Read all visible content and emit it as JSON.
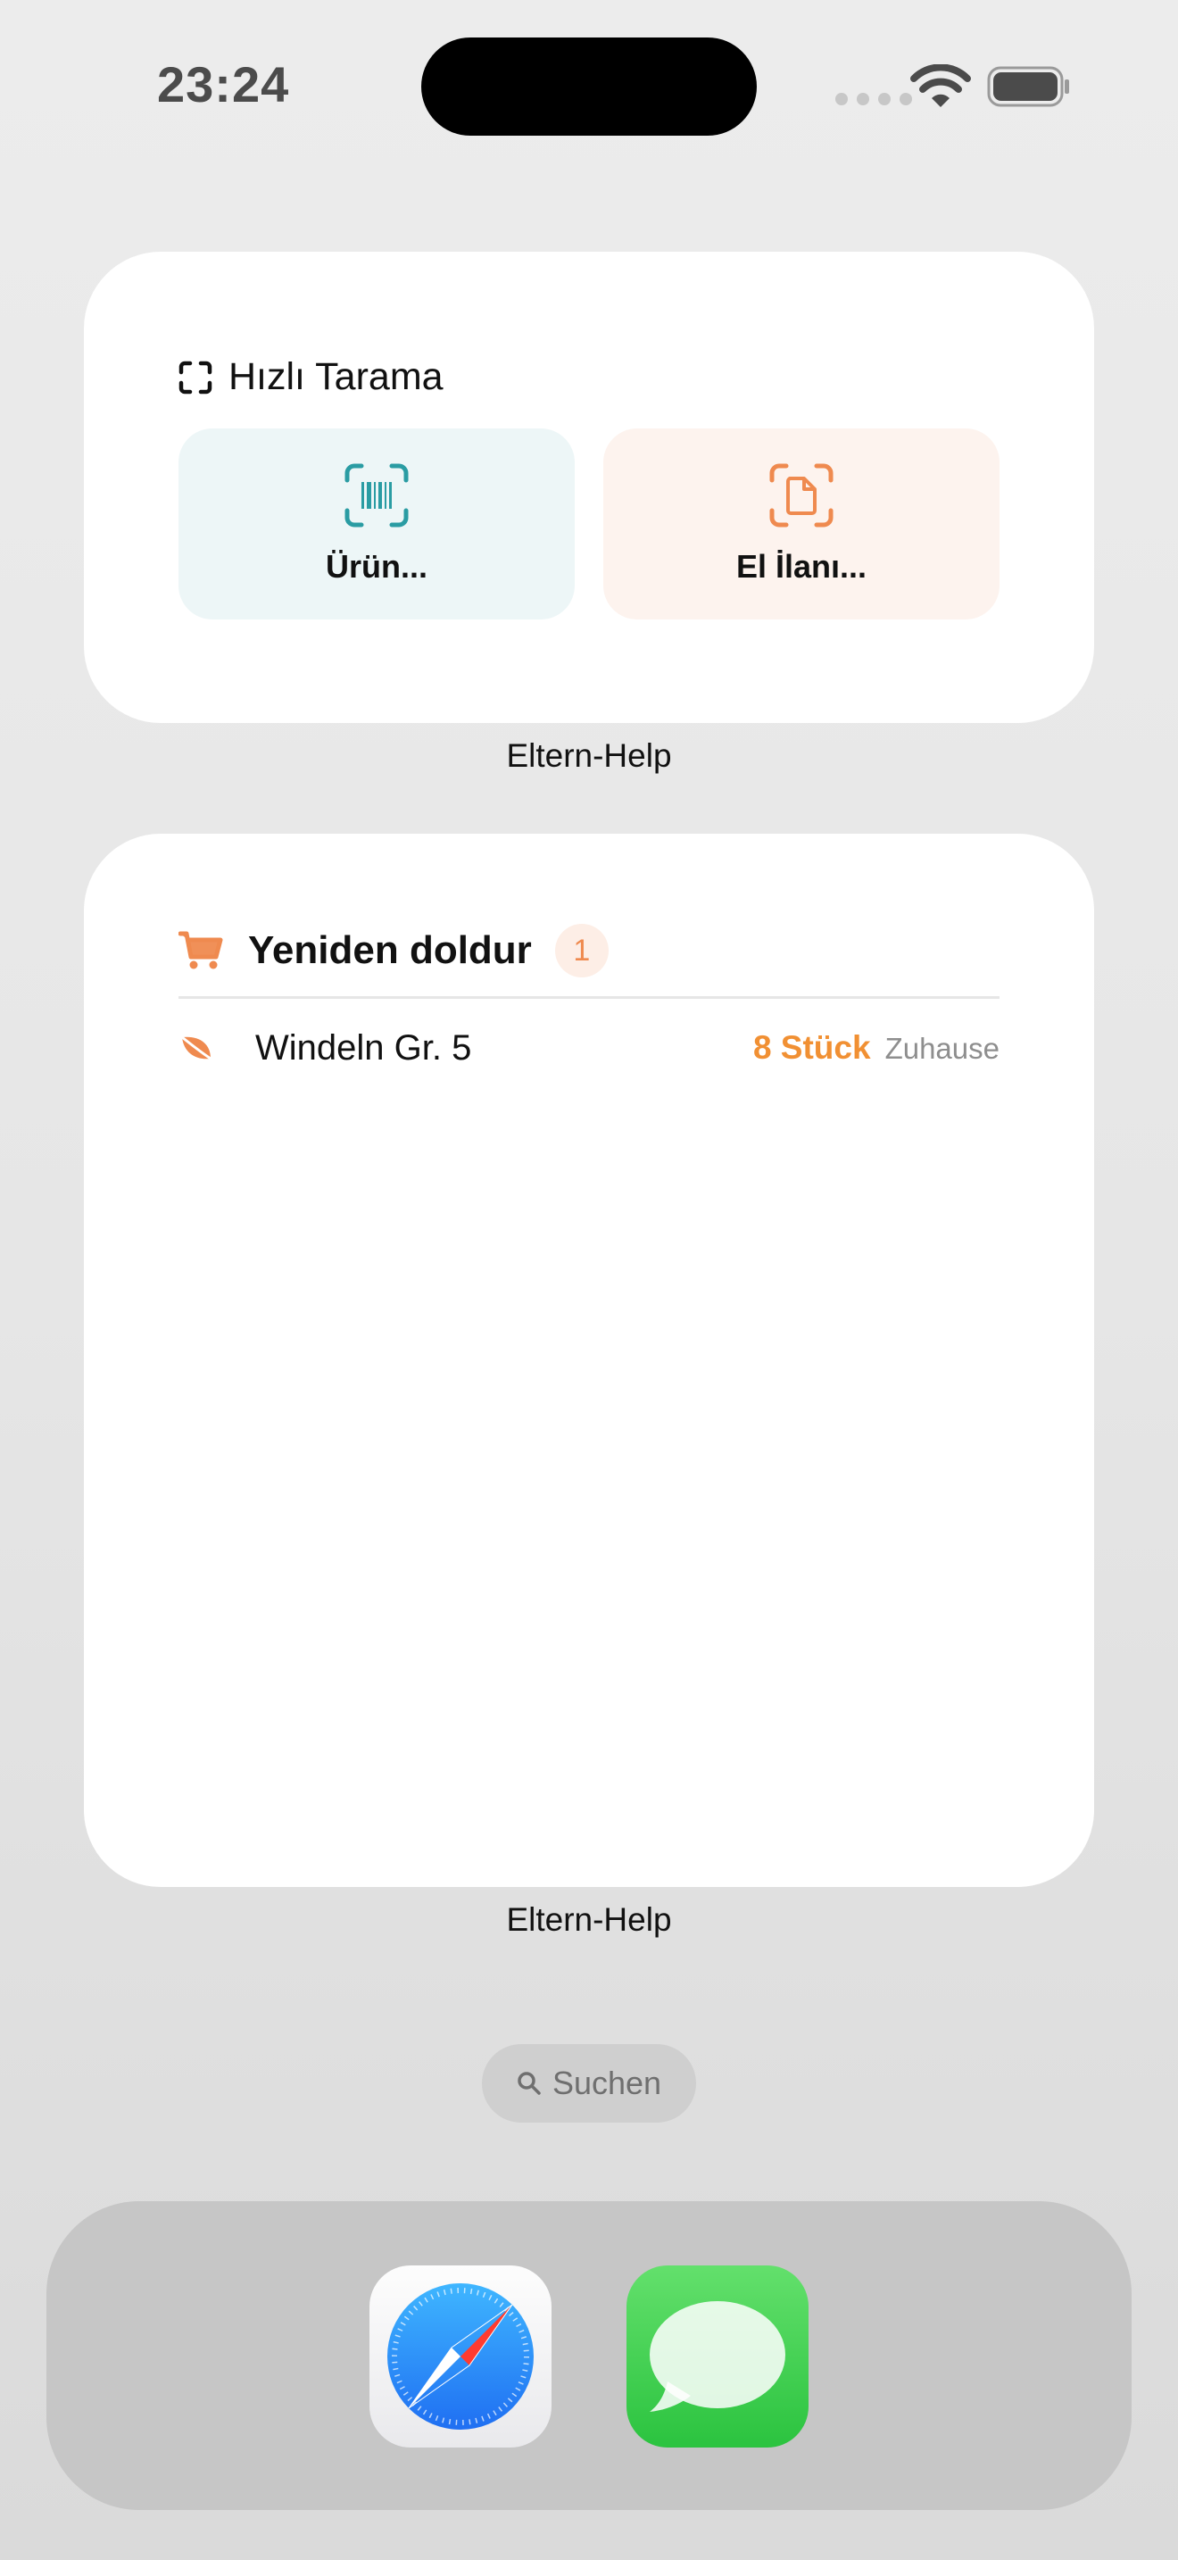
{
  "status_bar": {
    "time": "23:24"
  },
  "widgets": {
    "quick_scan": {
      "title": "Hızlı Tarama",
      "product_label": "Ürün...",
      "flyer_label": "El İlanı...",
      "caption": "Eltern-Help"
    },
    "refill": {
      "title": "Yeniden doldur",
      "count": "1",
      "items": [
        {
          "name": "Windeln Gr. 5",
          "quantity": "8 Stück",
          "location": "Zuhause"
        }
      ],
      "caption": "Eltern-Help"
    }
  },
  "search": {
    "label": "Suchen"
  },
  "dock": {
    "apps": [
      {
        "icon": "safari-icon"
      },
      {
        "icon": "messages-icon"
      }
    ]
  },
  "colors": {
    "teal_accent": "#2a9ca3",
    "orange_accent": "#ef8a4f",
    "quantity_orange": "#f19033"
  }
}
